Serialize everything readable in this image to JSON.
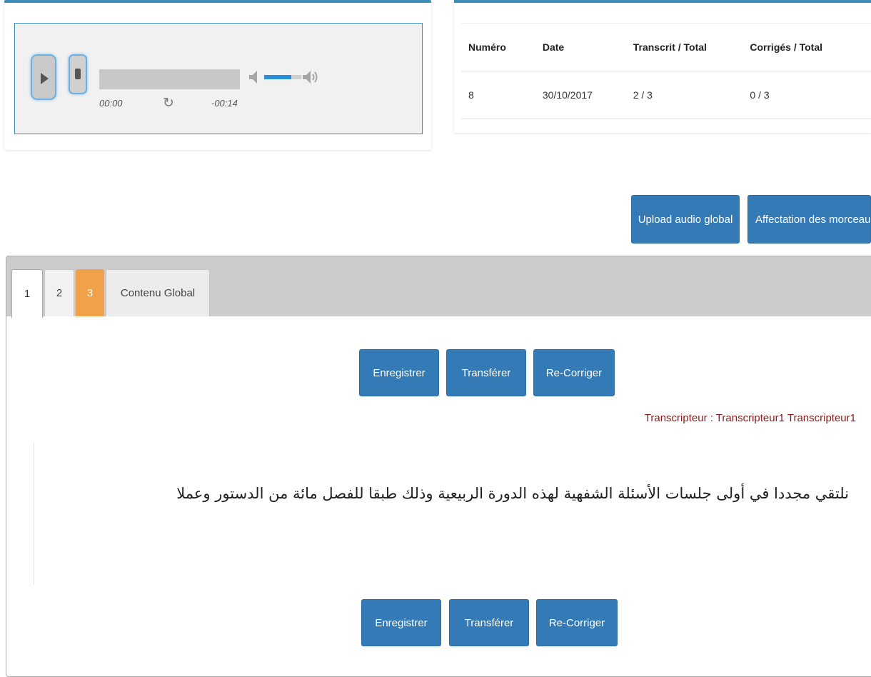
{
  "player": {
    "current_time": "00:00",
    "remaining_time": "-00:14",
    "icons": [
      "play-icon",
      "stop-icon",
      "loop-icon",
      "volume-low-icon",
      "volume-high-icon"
    ],
    "volume_level": 0.73
  },
  "summary": {
    "headers": [
      "Numéro",
      "Date",
      "Transcrit / Total",
      "Corrigés / Total"
    ],
    "row": [
      "8",
      "30/10/2017",
      "2 / 3",
      "0 / 3"
    ]
  },
  "actions": {
    "upload": "Upload audio global",
    "affect": "Affectation des morceaux"
  },
  "tabs": [
    {
      "label": "1"
    },
    {
      "label": "2"
    },
    {
      "label": "3"
    },
    {
      "label": "Contenu Global"
    }
  ],
  "panel": {
    "save": "Enregistrer",
    "transfer": "Transférer",
    "recorrect": "Re-Corriger",
    "transcriber": "Transcripteur : Transcripteur1 Transcripteur1",
    "text": "نلتقي مجددا في أولى جلسات الأسئلة الشفهية لهذه الدورة الربيعية وذلك طبقا للفصل مائة من الدستور وعملا"
  },
  "colors": {
    "primary": "#337ab7",
    "accent_tab": "#f0a14a",
    "card_border": "#3c8dbc",
    "transcriber_text": "#8b1a1a"
  }
}
